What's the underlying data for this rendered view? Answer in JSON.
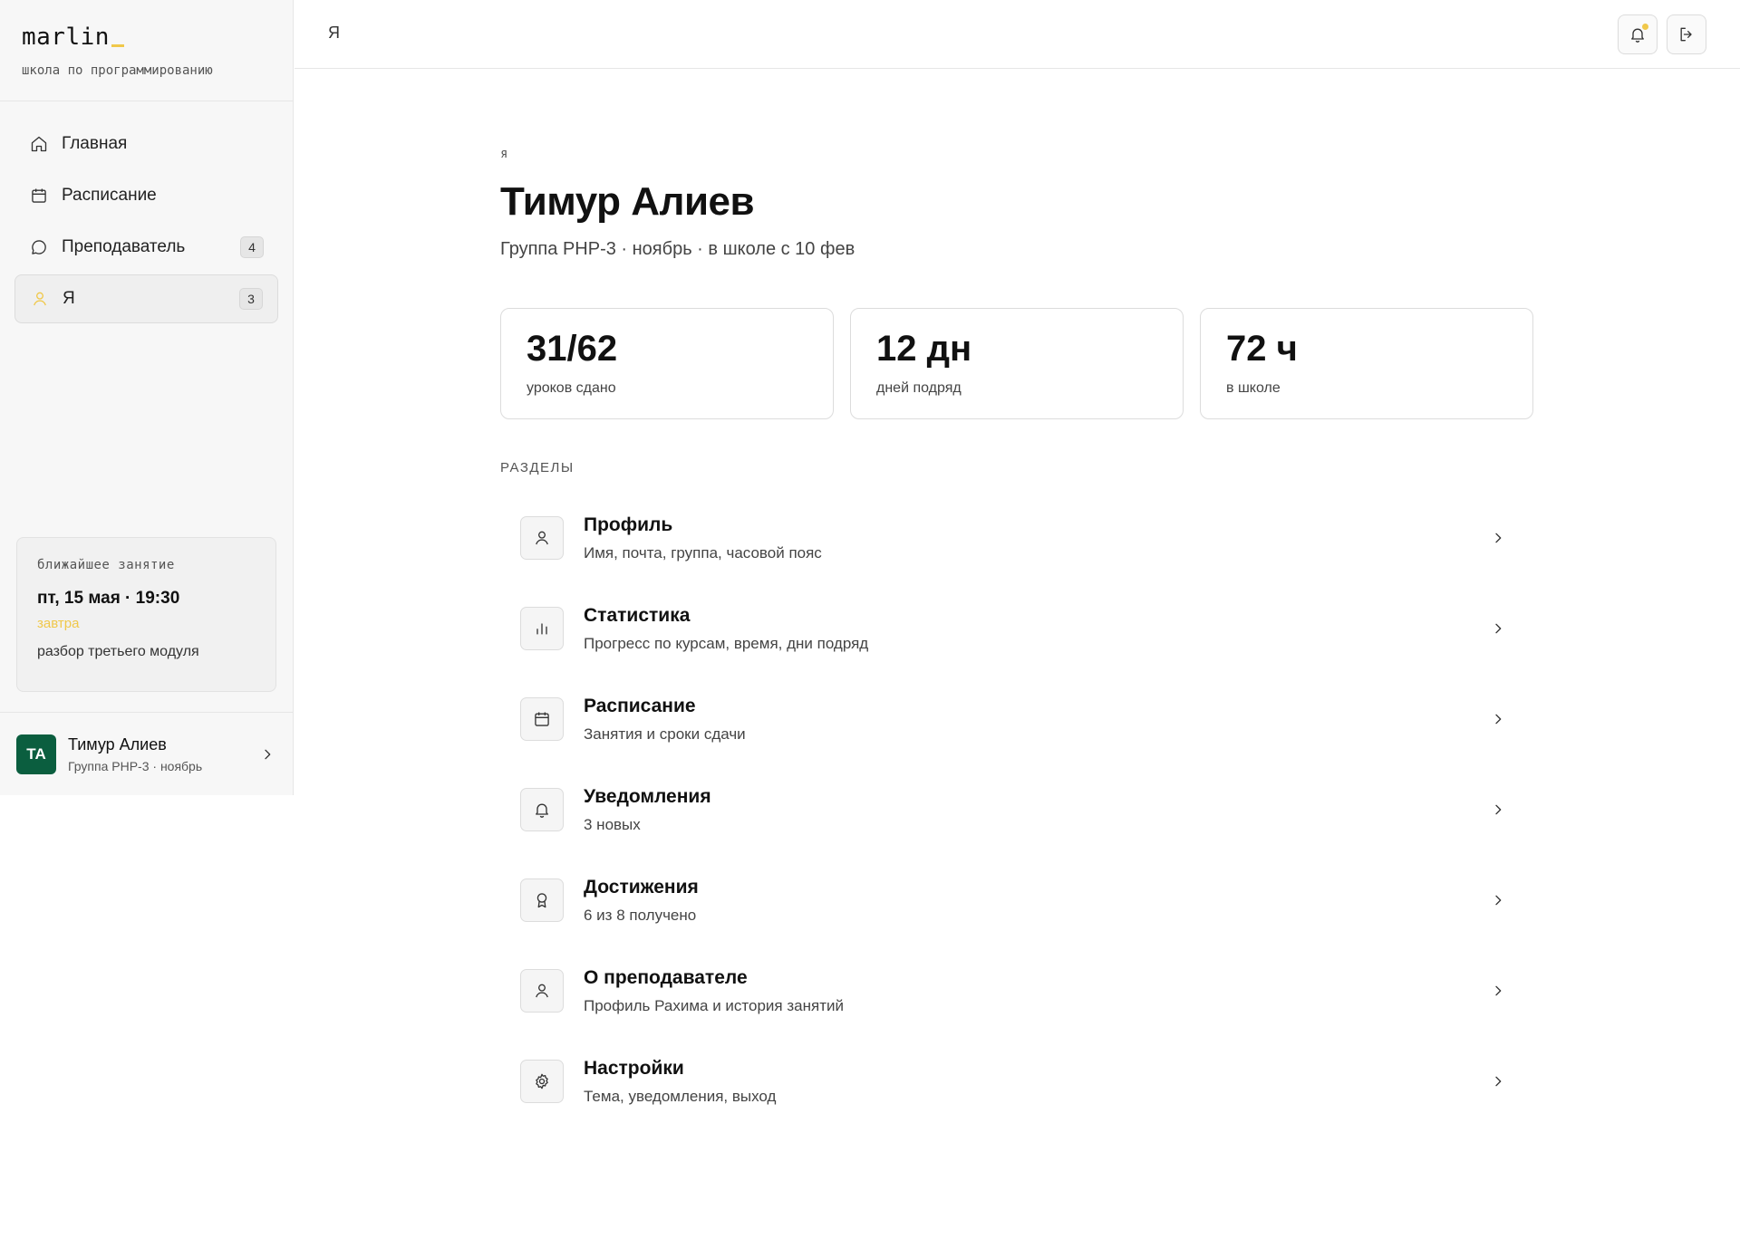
{
  "brand": {
    "name": "marlin",
    "tagline": "школа по программированию"
  },
  "nav": {
    "items": [
      {
        "label": "Главная",
        "icon": "home-icon"
      },
      {
        "label": "Расписание",
        "icon": "calendar-icon"
      },
      {
        "label": "Преподаватель",
        "icon": "chat-icon",
        "badge": "4"
      },
      {
        "label": "Я",
        "icon": "user-icon",
        "badge": "3",
        "active": true
      }
    ]
  },
  "next_lesson": {
    "label": "ближайшее занятие",
    "date": "пт, 15 мая · 19:30",
    "when": "завтра",
    "description": "разбор третьего модуля"
  },
  "user": {
    "initials": "ТА",
    "name": "Тимур Алиев",
    "group": "Группа PHP-3 · ноябрь"
  },
  "topbar": {
    "title": "Я"
  },
  "page": {
    "breadcrumb": "я",
    "title": "Тимур Алиев",
    "subtitle": "Группа PHP-3 · ноябрь · в школе с 10 фев"
  },
  "stats": [
    {
      "value": "31/62",
      "label": "уроков сдано"
    },
    {
      "value": "12 дн",
      "label": "дней подряд"
    },
    {
      "value": "72 ч",
      "label": "в школе"
    }
  ],
  "sections": {
    "label": "РАЗДЕЛЫ",
    "items": [
      {
        "title": "Профиль",
        "subtitle": "Имя, почта, группа, часовой пояс",
        "icon": "user-icon"
      },
      {
        "title": "Статистика",
        "subtitle": "Прогресс по курсам, время, дни подряд",
        "icon": "bar-chart-icon"
      },
      {
        "title": "Расписание",
        "subtitle": "Занятия и сроки сдачи",
        "icon": "calendar-icon"
      },
      {
        "title": "Уведомления",
        "subtitle": "3 новых",
        "icon": "bell-icon"
      },
      {
        "title": "Достижения",
        "subtitle": "6 из 8 получено",
        "icon": "award-icon"
      },
      {
        "title": "О преподавателе",
        "subtitle": "Профиль Рахима и история занятий",
        "icon": "user-icon"
      },
      {
        "title": "Настройки",
        "subtitle": "Тема, уведомления, выход",
        "icon": "gear-icon"
      }
    ]
  },
  "colors": {
    "accent": "#f0c84a",
    "avatar_bg": "#0b5e3f"
  }
}
